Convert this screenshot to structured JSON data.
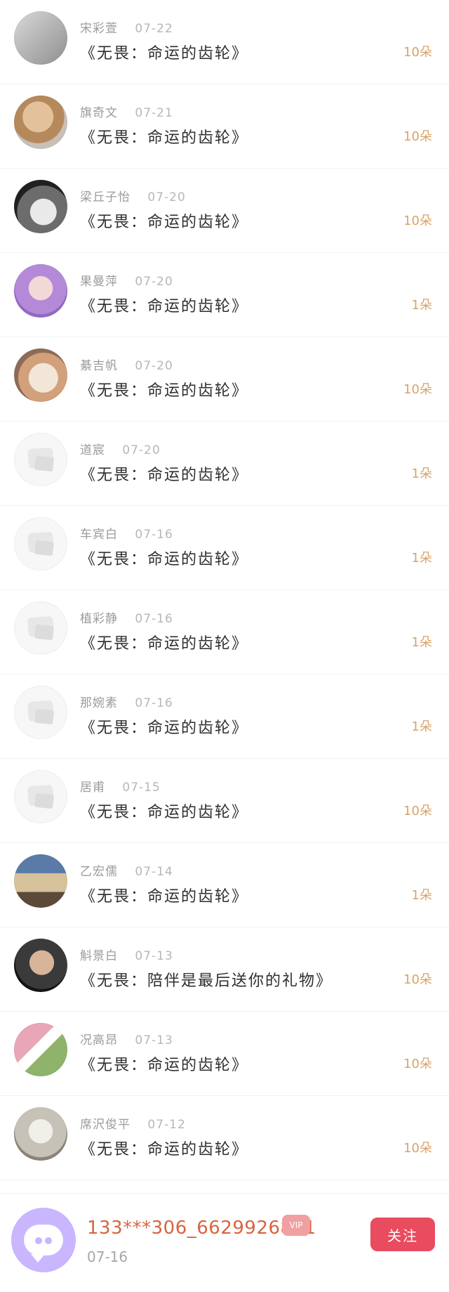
{
  "list": {
    "rows": [
      {
        "name": "宋彩萱",
        "date": "07-22",
        "title": "《无畏：命运的齿轮》",
        "amount": "10朵"
      },
      {
        "name": "旗奇文",
        "date": "07-21",
        "title": "《无畏：命运的齿轮》",
        "amount": "10朵"
      },
      {
        "name": "梁丘子怡",
        "date": "07-20",
        "title": "《无畏：命运的齿轮》",
        "amount": "10朵"
      },
      {
        "name": "果曼萍",
        "date": "07-20",
        "title": "《无畏：命运的齿轮》",
        "amount": "1朵"
      },
      {
        "name": "綦吉帆",
        "date": "07-20",
        "title": "《无畏：命运的齿轮》",
        "amount": "10朵"
      },
      {
        "name": "道宸",
        "date": "07-20",
        "title": "《无畏：命运的齿轮》",
        "amount": "1朵"
      },
      {
        "name": "车宾白",
        "date": "07-16",
        "title": "《无畏：命运的齿轮》",
        "amount": "1朵"
      },
      {
        "name": "植彩静",
        "date": "07-16",
        "title": "《无畏：命运的齿轮》",
        "amount": "1朵"
      },
      {
        "name": "那婉素",
        "date": "07-16",
        "title": "《无畏：命运的齿轮》",
        "amount": "1朵"
      },
      {
        "name": "居甫",
        "date": "07-15",
        "title": "《无畏：命运的齿轮》",
        "amount": "10朵"
      },
      {
        "name": "乙宏儒",
        "date": "07-14",
        "title": "《无畏：命运的齿轮》",
        "amount": "1朵"
      },
      {
        "name": "斛景白",
        "date": "07-13",
        "title": "《无畏：陪伴是最后送你的礼物》",
        "amount": "10朵"
      },
      {
        "name": "况高昂",
        "date": "07-13",
        "title": "《无畏：命运的齿轮》",
        "amount": "10朵"
      },
      {
        "name": "席沢俊平",
        "date": "07-12",
        "title": "《无畏：命运的齿轮》",
        "amount": "10朵"
      }
    ]
  },
  "bottom": {
    "username": "133***306_6629926821",
    "vip_badge": "VIP",
    "date": "07-16",
    "follow_label": "关注"
  },
  "colors": {
    "amount": "#d9a36a",
    "username": "#d7643f",
    "follow_button": "#e94b5f"
  },
  "icons": {
    "avatar_placeholder": "image-placeholder-icon",
    "bottom_avatar": "chat-bubble-icon",
    "vip_badge": "diamond-vip-icon"
  }
}
